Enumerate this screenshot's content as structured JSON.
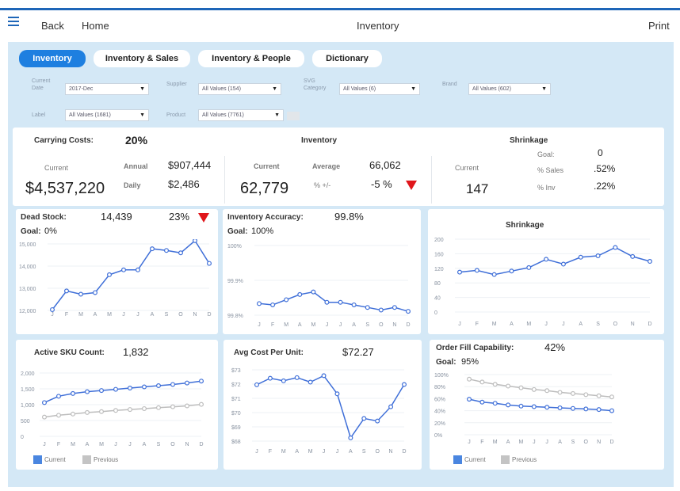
{
  "topbar": {
    "back": "Back",
    "home": "Home",
    "title": "Inventory",
    "print": "Print"
  },
  "tabs": [
    "Inventory",
    "Inventory & Sales",
    "Inventory & People",
    "Dictionary"
  ],
  "filters": {
    "current_date": {
      "label1": "Current",
      "label2": "Date",
      "value": "2017-Dec"
    },
    "supplier": {
      "label": "Supplier",
      "value": "All Values (154)"
    },
    "svg_category": {
      "label1": "SVG",
      "label2": "Category",
      "value": "All Values (6)"
    },
    "brand": {
      "label": "Brand",
      "value": "All Values (602)"
    },
    "label": {
      "label": "Label",
      "value": "All Values (1681)"
    },
    "product": {
      "label": "Product",
      "value": "All Values (7761)"
    }
  },
  "carrying": {
    "title": "Carrying Costs:",
    "pct": "20%",
    "current_label": "Current",
    "current": "$4,537,220",
    "annual_label": "Annual",
    "annual": "$907,444",
    "daily_label": "Daily",
    "daily": "$2,486"
  },
  "inventory": {
    "title": "Inventory",
    "current_label": "Current",
    "current": "62,779",
    "average_label": "Average",
    "average": "66,062",
    "change_label": "% +/-",
    "change": "-5 %"
  },
  "shrinkage_kpi": {
    "title": "Shrinkage",
    "current_label": "Current",
    "current": "147",
    "goal_label": "Goal:",
    "goal": "0",
    "sales_label": "% Sales",
    "sales": ".52%",
    "inv_label": "% Inv",
    "inv": ".22%"
  },
  "dead_stock": {
    "title": "Dead Stock:",
    "value": "14,439",
    "pct": "23%",
    "goal_label": "Goal:",
    "goal": "0%"
  },
  "accuracy": {
    "title": "Inventory Accuracy:",
    "value": "99.8%",
    "goal_label": "Goal:",
    "goal": "100%"
  },
  "shrinkage_chart": {
    "title": "Shrinkage"
  },
  "active_sku": {
    "title": "Active SKU Count:",
    "value": "1,832",
    "legend_current": "Current",
    "legend_previous": "Previous"
  },
  "avg_cost": {
    "title": "Avg Cost Per Unit:",
    "value": "$72.27"
  },
  "order_fill": {
    "title": "Order Fill Capability:",
    "value": "42%",
    "goal_label": "Goal:",
    "goal": "95%",
    "legend_current": "Current",
    "legend_previous": "Previous"
  },
  "colors": {
    "accent": "#1e7fe0",
    "line": "#3f6fd8",
    "previous": "#bdbdbd",
    "alert": "#e0161b",
    "background": "#d4e8f6"
  },
  "chart_data": [
    {
      "id": "dead",
      "type": "line",
      "x": [
        "J",
        "F",
        "M",
        "A",
        "M",
        "J",
        "J",
        "A",
        "S",
        "O",
        "N",
        "D"
      ],
      "yticks": [
        "15,000",
        "14,000",
        "13,000",
        "12,000"
      ],
      "ylim": [
        11500,
        15600
      ],
      "series": [
        {
          "values": [
            11550,
            12700,
            12500,
            12600,
            13700,
            14000,
            14000,
            15300,
            15200,
            15050,
            15800,
            14400
          ]
        }
      ]
    },
    {
      "id": "acc",
      "type": "line",
      "x": [
        "J",
        "F",
        "M",
        "A",
        "M",
        "J",
        "J",
        "A",
        "S",
        "O",
        "N",
        "D"
      ],
      "yticks": [
        "100%",
        "99.9%",
        "99.8%"
      ],
      "ylim": [
        99.76,
        100.03
      ],
      "series": [
        {
          "values": [
            99.805,
            99.8,
            99.82,
            99.84,
            99.85,
            99.81,
            99.81,
            99.8,
            99.79,
            99.78,
            99.79,
            99.775
          ]
        }
      ]
    },
    {
      "id": "shr",
      "type": "line",
      "x": [
        "J",
        "F",
        "M",
        "A",
        "M",
        "J",
        "J",
        "A",
        "S",
        "O",
        "N",
        "D"
      ],
      "yticks": [
        "200",
        "160",
        "120",
        "80",
        "40",
        "0"
      ],
      "ylim": [
        0,
        210
      ],
      "series": [
        {
          "values": [
            115,
            120,
            108,
            118,
            128,
            152,
            138,
            158,
            162,
            186,
            160,
            146
          ]
        }
      ]
    },
    {
      "id": "sku",
      "type": "line",
      "x": [
        "J",
        "F",
        "M",
        "A",
        "M",
        "J",
        "J",
        "A",
        "S",
        "O",
        "N",
        "D"
      ],
      "yticks": [
        "2,000",
        "1,500",
        "1,000",
        "500",
        "0"
      ],
      "ylim": [
        0,
        2100
      ],
      "series": [
        {
          "name": "Current",
          "values": [
            1120,
            1330,
            1420,
            1480,
            1520,
            1560,
            1600,
            1640,
            1680,
            1720,
            1770,
            1832
          ]
        },
        {
          "name": "Previous",
          "values": [
            640,
            700,
            740,
            790,
            820,
            860,
            890,
            920,
            950,
            980,
            1010,
            1060
          ]
        }
      ]
    },
    {
      "id": "cost",
      "type": "line",
      "x": [
        "J",
        "F",
        "M",
        "A",
        "M",
        "J",
        "J",
        "A",
        "S",
        "O",
        "N",
        "D"
      ],
      "yticks": [
        "$73",
        "$72",
        "$71",
        "$70",
        "$69",
        "$68"
      ],
      "ylim": [
        67.9,
        73.4
      ],
      "series": [
        {
          "values": [
            72.25,
            72.75,
            72.55,
            72.8,
            72.45,
            72.95,
            71.55,
            68.15,
            69.65,
            69.45,
            70.55,
            72.27
          ]
        }
      ]
    },
    {
      "id": "fill",
      "type": "line",
      "x": [
        "J",
        "F",
        "M",
        "A",
        "M",
        "J",
        "J",
        "A",
        "S",
        "O",
        "N",
        "D"
      ],
      "yticks": [
        "100%",
        "80%",
        "60%",
        "40%",
        "20%",
        "0%"
      ],
      "ylim": [
        0,
        105
      ],
      "series": [
        {
          "name": "Current",
          "values": [
            62,
            57,
            55,
            52,
            50,
            49,
            48,
            47,
            46,
            45,
            44,
            42
          ]
        },
        {
          "name": "Previous",
          "values": [
            97,
            92,
            88,
            85,
            82,
            79,
            77,
            74,
            72,
            70,
            68,
            66
          ]
        }
      ]
    }
  ]
}
